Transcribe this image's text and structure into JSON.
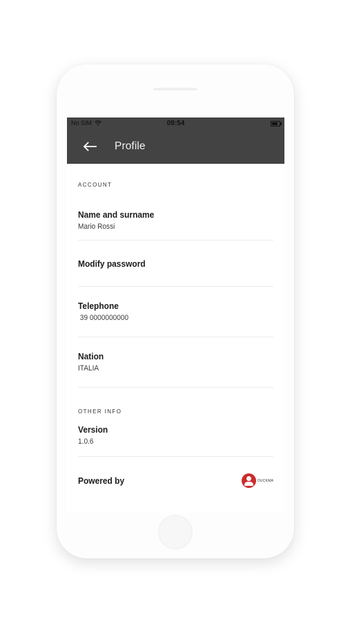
{
  "status_bar": {
    "carrier": "No SIM",
    "time": "09:54"
  },
  "header": {
    "title": "Profile"
  },
  "sections": {
    "account": "ACCOUNT",
    "other_info": "OTHER INFO"
  },
  "rows": {
    "name": {
      "title": "Name and surname",
      "value": "Mario Rossi"
    },
    "password": {
      "title": "Modify password"
    },
    "telephone": {
      "title": "Telephone",
      "value": " 39 0000000000"
    },
    "nation": {
      "title": "Nation",
      "value": "ITALIA"
    },
    "version": {
      "title": "Version",
      "value": "1.0.6"
    },
    "powered": {
      "title": "Powered by",
      "logo_text": "DUCKMA"
    }
  },
  "colors": {
    "app_bar": "#434343",
    "logo_red": "#cc2b2b"
  }
}
